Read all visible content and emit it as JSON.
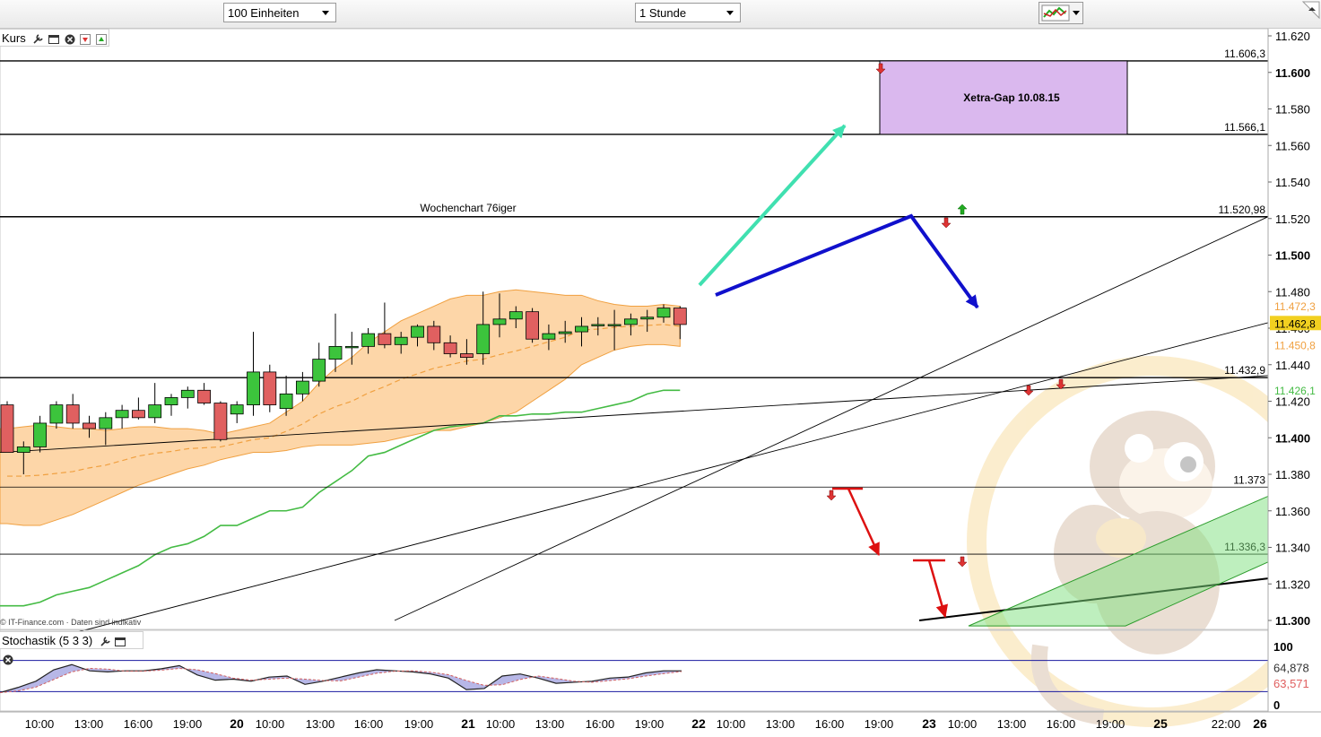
{
  "toolbar": {
    "units_select": "100 Einheiten",
    "interval_select": "1 Stunde"
  },
  "price_panel": {
    "label": "Kurs",
    "copyright": "© IT-Finance.com · Daten sind indikativ"
  },
  "stoch_panel": {
    "label": "Stochastik (5 3 3)"
  },
  "colors": {
    "candle_up": "#3cc43c",
    "candle_down": "#e06060",
    "band_fill": "#fdd6a8",
    "band_line": "#f0a040",
    "green_line": "#44bb44",
    "teal_arrow": "#40e0b0",
    "blue_arrow": "#1010cc",
    "red_arrow": "#dd1111",
    "gap_box": "#dab8ee",
    "current_price_bg": "#f2d020",
    "stoch_fill": "#9898dd"
  },
  "chart_data": {
    "type": "candlestick",
    "y_axis_ticks": [
      "11.620",
      "11.600",
      "11.580",
      "11.560",
      "11.540",
      "11.520",
      "11.500",
      "11.480",
      "11.460",
      "11.440",
      "11.420",
      "11.400",
      "11.380",
      "11.360",
      "11.340",
      "11.320",
      "11.300"
    ],
    "ylim": [
      11.295,
      11.625
    ],
    "x_tick_labels": [
      "10:00",
      "13:00",
      "16:00",
      "19:00",
      "20",
      "10:00",
      "13:00",
      "16:00",
      "19:00",
      "21",
      "10:00",
      "13:00",
      "16:00",
      "19:00",
      "22",
      "10:00",
      "13:00",
      "16:00",
      "19:00",
      "23",
      "10:00",
      "13:00",
      "16:00",
      "19:00",
      "25",
      "22:00",
      "26"
    ],
    "horizontal_levels": [
      {
        "value": 11.6063,
        "label": "11.606,3"
      },
      {
        "value": 11.5661,
        "label": "11.566,1"
      },
      {
        "value": 11.52098,
        "label": "11.520,98"
      },
      {
        "value": 11.4329,
        "label": "11.432,9"
      },
      {
        "value": 11.373,
        "label": "11.373"
      },
      {
        "value": 11.3363,
        "label": "11.336,3"
      }
    ],
    "annotations": {
      "gap_box_label": "Xetra-Gap 10.08.15",
      "level_label": "Wochenchart 76iger"
    },
    "price_labels": {
      "band_upper": "11.472,3",
      "current": "11.462,8",
      "band_lower": "11.450,8",
      "green_line": "11.426,1"
    },
    "candles": [
      {
        "o": 11.418,
        "h": 11.42,
        "l": 11.392,
        "c": 11.392
      },
      {
        "o": 11.392,
        "h": 11.398,
        "l": 11.38,
        "c": 11.395
      },
      {
        "o": 11.395,
        "h": 11.412,
        "l": 11.392,
        "c": 11.408
      },
      {
        "o": 11.408,
        "h": 11.42,
        "l": 11.405,
        "c": 11.418
      },
      {
        "o": 11.418,
        "h": 11.424,
        "l": 11.405,
        "c": 11.408
      },
      {
        "o": 11.408,
        "h": 11.412,
        "l": 11.4,
        "c": 11.405
      },
      {
        "o": 11.405,
        "h": 11.414,
        "l": 11.396,
        "c": 11.411
      },
      {
        "o": 11.411,
        "h": 11.418,
        "l": 11.405,
        "c": 11.415
      },
      {
        "o": 11.415,
        "h": 11.422,
        "l": 11.41,
        "c": 11.411
      },
      {
        "o": 11.411,
        "h": 11.43,
        "l": 11.408,
        "c": 11.418
      },
      {
        "o": 11.418,
        "h": 11.424,
        "l": 11.412,
        "c": 11.422
      },
      {
        "o": 11.422,
        "h": 11.428,
        "l": 11.416,
        "c": 11.426
      },
      {
        "o": 11.426,
        "h": 11.43,
        "l": 11.418,
        "c": 11.419
      },
      {
        "o": 11.419,
        "h": 11.42,
        "l": 11.398,
        "c": 11.399
      },
      {
        "o": 11.413,
        "h": 11.42,
        "l": 11.408,
        "c": 11.418
      },
      {
        "o": 11.418,
        "h": 11.458,
        "l": 11.412,
        "c": 11.436
      },
      {
        "o": 11.436,
        "h": 11.44,
        "l": 11.414,
        "c": 11.418
      },
      {
        "o": 11.416,
        "h": 11.434,
        "l": 11.412,
        "c": 11.424
      },
      {
        "o": 11.424,
        "h": 11.436,
        "l": 11.42,
        "c": 11.431
      },
      {
        "o": 11.431,
        "h": 11.452,
        "l": 11.428,
        "c": 11.443
      },
      {
        "o": 11.443,
        "h": 11.468,
        "l": 11.436,
        "c": 11.45
      },
      {
        "o": 11.45,
        "h": 11.458,
        "l": 11.44,
        "c": 11.45
      },
      {
        "o": 11.45,
        "h": 11.46,
        "l": 11.446,
        "c": 11.457
      },
      {
        "o": 11.457,
        "h": 11.474,
        "l": 11.449,
        "c": 11.451
      },
      {
        "o": 11.451,
        "h": 11.458,
        "l": 11.446,
        "c": 11.455
      },
      {
        "o": 11.455,
        "h": 11.462,
        "l": 11.45,
        "c": 11.461
      },
      {
        "o": 11.461,
        "h": 11.464,
        "l": 11.448,
        "c": 11.452
      },
      {
        "o": 11.452,
        "h": 11.456,
        "l": 11.444,
        "c": 11.446
      },
      {
        "o": 11.446,
        "h": 11.454,
        "l": 11.44,
        "c": 11.444
      },
      {
        "o": 11.446,
        "h": 11.48,
        "l": 11.44,
        "c": 11.462
      },
      {
        "o": 11.462,
        "h": 11.479,
        "l": 11.455,
        "c": 11.465
      },
      {
        "o": 11.465,
        "h": 11.472,
        "l": 11.46,
        "c": 11.469
      },
      {
        "o": 11.469,
        "h": 11.471,
        "l": 11.452,
        "c": 11.454
      },
      {
        "o": 11.454,
        "h": 11.462,
        "l": 11.448,
        "c": 11.457
      },
      {
        "o": 11.457,
        "h": 11.464,
        "l": 11.452,
        "c": 11.458
      },
      {
        "o": 11.458,
        "h": 11.466,
        "l": 11.45,
        "c": 11.461
      },
      {
        "o": 11.462,
        "h": 11.466,
        "l": 11.456,
        "c": 11.462
      },
      {
        "o": 11.462,
        "h": 11.47,
        "l": 11.448,
        "c": 11.462
      },
      {
        "o": 11.462,
        "h": 11.468,
        "l": 11.456,
        "c": 11.465
      },
      {
        "o": 11.465,
        "h": 11.47,
        "l": 11.458,
        "c": 11.466
      },
      {
        "o": 11.466,
        "h": 11.473,
        "l": 11.463,
        "c": 11.471
      },
      {
        "o": 11.471,
        "h": 11.472,
        "l": 11.454,
        "c": 11.462
      }
    ],
    "stochastic": {
      "ylim": [
        0,
        100
      ],
      "tick_labels": [
        "100",
        "64,878",
        "63,571",
        "0"
      ],
      "levels": [
        80,
        20
      ],
      "k": [
        18,
        28,
        40,
        62,
        72,
        60,
        58,
        60,
        60,
        64,
        70,
        52,
        42,
        44,
        40,
        48,
        50,
        34,
        40,
        48,
        56,
        62,
        60,
        58,
        54,
        46,
        24,
        26,
        50,
        54,
        46,
        36,
        38,
        40,
        46,
        48,
        56,
        60,
        60
      ]
    }
  }
}
